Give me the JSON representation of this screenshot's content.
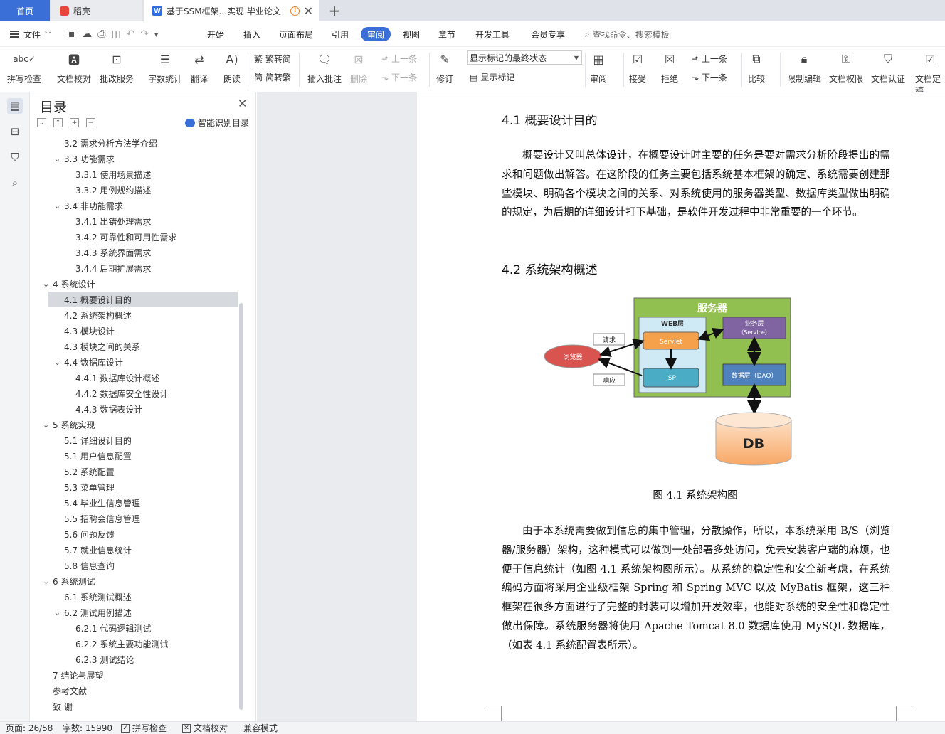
{
  "tabs": {
    "home": "首页",
    "draft": "稻壳",
    "doc": "基于SSM框架...实现 毕业论文",
    "add": "+"
  },
  "menu": {
    "file": "文件",
    "items": [
      "开始",
      "插入",
      "页面布局",
      "引用",
      "审阅",
      "视图",
      "章节",
      "开发工具",
      "会员专享"
    ],
    "active": "审阅",
    "search": "查找命令、搜索模板"
  },
  "ribbon": {
    "spell_check": "拼写检查",
    "doc_proof": "文档校对",
    "batch_service": "批改服务",
    "word_count": "字数统计",
    "translate": "翻译",
    "read_aloud": "朗读",
    "to_traditional": "繁转简",
    "to_simplified": "简转繁",
    "insert_comment": "插入批注",
    "delete": "删除",
    "prev_item": "上一条",
    "next_item": "下一条",
    "track_changes": "修订",
    "display_select": "显示标记的最终状态",
    "show_markup": "显示标记",
    "review": "审阅",
    "accept": "接受",
    "reject": "拒绝",
    "prev_change": "上一条",
    "next_change": "下一条",
    "compare": "比较",
    "restrict_edit": "限制编辑",
    "doc_permission": "文档权限",
    "doc_auth": "文档认证",
    "doc_final": "文档定稿"
  },
  "toc": {
    "title": "目录",
    "ai_label": "智能识别目录",
    "items": [
      {
        "text": "3.2  需求分析方法学介绍",
        "level": 2,
        "toggle": ""
      },
      {
        "text": "3.3 功能需求",
        "level": 2,
        "toggle": "v"
      },
      {
        "text": "3.3.1 使用场景描述",
        "level": 3,
        "toggle": ""
      },
      {
        "text": "3.3.2 用例规约描述",
        "level": 3,
        "toggle": ""
      },
      {
        "text": "3.4  非功能需求",
        "level": 2,
        "toggle": "v"
      },
      {
        "text": "3.4.1  出错处理需求",
        "level": 3,
        "toggle": ""
      },
      {
        "text": "3.4.2  可靠性和可用性需求",
        "level": 3,
        "toggle": ""
      },
      {
        "text": "3.4.3  系统界面需求",
        "level": 3,
        "toggle": ""
      },
      {
        "text": "3.4.4  后期扩展需求",
        "level": 3,
        "toggle": ""
      },
      {
        "text": "4  系统设计",
        "level": 1,
        "toggle": "v"
      },
      {
        "text": "4.1  概要设计目的",
        "level": 2,
        "toggle": "",
        "selected": true
      },
      {
        "text": "4.2  系统架构概述",
        "level": 2,
        "toggle": ""
      },
      {
        "text": "4.3  模块设计",
        "level": 2,
        "toggle": ""
      },
      {
        "text": "4.3  模块之间的关系",
        "level": 2,
        "toggle": ""
      },
      {
        "text": "4.4  数据库设计",
        "level": 2,
        "toggle": "v"
      },
      {
        "text": "4.4.1  数据库设计概述",
        "level": 3,
        "toggle": ""
      },
      {
        "text": "4.4.2  数据库安全性设计",
        "level": 3,
        "toggle": ""
      },
      {
        "text": "4.4.3 数据表设计",
        "level": 3,
        "toggle": ""
      },
      {
        "text": "5  系统实现",
        "level": 1,
        "toggle": "v"
      },
      {
        "text": "5.1  详细设计目的",
        "level": 2,
        "toggle": ""
      },
      {
        "text": "5.1  用户信息配置",
        "level": 2,
        "toggle": ""
      },
      {
        "text": "5.2  系统配置",
        "level": 2,
        "toggle": ""
      },
      {
        "text": "5.3  菜单管理",
        "level": 2,
        "toggle": ""
      },
      {
        "text": "5.4  毕业生信息管理",
        "level": 2,
        "toggle": ""
      },
      {
        "text": "5.5  招聘会信息管理",
        "level": 2,
        "toggle": ""
      },
      {
        "text": "5.6  问题反馈",
        "level": 2,
        "toggle": ""
      },
      {
        "text": "5.7  就业信息统计",
        "level": 2,
        "toggle": ""
      },
      {
        "text": "5.8  信息查询",
        "level": 2,
        "toggle": ""
      },
      {
        "text": "6  系统测试",
        "level": 1,
        "toggle": "v"
      },
      {
        "text": "6.1  系统测试概述",
        "level": 2,
        "toggle": ""
      },
      {
        "text": "6.2  测试用例描述",
        "level": 2,
        "toggle": "v"
      },
      {
        "text": "6.2.1  代码逻辑测试",
        "level": 3,
        "toggle": ""
      },
      {
        "text": "6.2.2  系统主要功能测试",
        "level": 3,
        "toggle": ""
      },
      {
        "text": "6.2.3  测试结论",
        "level": 3,
        "toggle": ""
      },
      {
        "text": "7 结论与展望",
        "level": 1,
        "toggle": ""
      },
      {
        "text": "参考文献",
        "level": 1,
        "toggle": ""
      },
      {
        "text": "致    谢",
        "level": 1,
        "toggle": ""
      }
    ]
  },
  "doc": {
    "h41": "4.1  概要设计目的",
    "p1": "概要设计又叫总体设计，在概要设计时主要的任务是要对需求分析阶段提出的需求和问题做出解答。在这阶段的任务主要包括系统基本框架的确定、系统需要创建那些模块、明确各个模块之间的关系、对系统使用的服务器类型、数据库类型做出明确的规定，为后期的详细设计打下基础，是软件开发过程中非常重要的一个环节。",
    "h42": "4.2  系统架构概述",
    "caption": "图  4.1  系统架构图",
    "p2": "由于本系统需要做到信息的集中管理，分散操作，所以，本系统采用 B/S（浏览器/服务器）架构，这种模式可以做到一处部署多处访问，免去安装客户端的麻烦，也便于信息统计（如图 4.1 系统架构图所示）。从系统的稳定性和安全新考虑，在系统编码方面将采用企业级框架 Spring 和 Spring MVC 以及 MyBatis 框架，这三种框架在很多方面进行了完整的封装可以增加开发效率，也能对系统的安全性和稳定性做出保障。系统服务器将使用 Apache Tomcat 8.0 数据库使用 MySQL 数据库，（如表 4.1 系统配置表所示）。"
  },
  "diagram": {
    "server": "服务器",
    "web_layer": "WEB层",
    "servlet": "Servlet",
    "jsp": "JSP",
    "business": "业务层",
    "service": "（Service）",
    "data_layer": "数据层（DAO）",
    "browser": "浏览器",
    "request": "请求",
    "response": "响应",
    "db": "DB"
  },
  "status": {
    "page": "页面: 26/58",
    "words": "字数: 15990",
    "spell": "拼写检查",
    "proof": "文档校对",
    "compat": "兼容模式"
  },
  "colors": {
    "accent": "#3b6fd8",
    "server_box": "#92c050",
    "web_box": "#cfeaf5",
    "servlet": "#f5a04a",
    "jsp": "#4bacc6",
    "business": "#8064a2",
    "data_layer": "#4f81bd",
    "browser": "#d9534f",
    "db": "#fac090"
  }
}
